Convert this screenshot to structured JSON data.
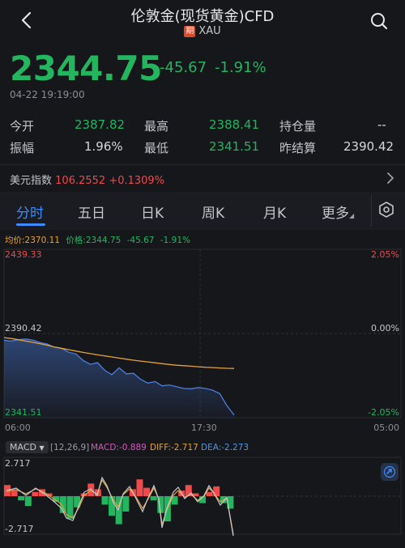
{
  "header": {
    "title": "伦敦金(现货黄金)CFD",
    "tag": "期",
    "code": "XAU"
  },
  "quote": {
    "price": "2344.75",
    "change": "-45.67",
    "change_pct": "-1.91%",
    "time": "04-22 19:19:00"
  },
  "stats": {
    "open_label": "今开",
    "open": "2387.82",
    "high_label": "最高",
    "high": "2388.41",
    "oi_label": "持仓量",
    "oi": "--",
    "amp_label": "振幅",
    "amp": "1.96%",
    "low_label": "最低",
    "low": "2341.51",
    "prev_label": "昨结算",
    "prev": "2390.42"
  },
  "usd_index": {
    "label": "美元指数",
    "value": "106.2552",
    "change": "+0.1309%"
  },
  "tabs": [
    "分时",
    "五日",
    "日K",
    "周K",
    "月K",
    "更多"
  ],
  "info_bar": {
    "avg": "均价:2370.11",
    "price": "价格:2344.75",
    "chg": "-45.67",
    "pct": "-1.91%"
  },
  "axis": {
    "y_top": "2439.33",
    "y_mid": "2390.42",
    "y_bot": "2341.51",
    "pct_top": "2.05%",
    "pct_mid": "0.00%",
    "pct_bot": "-2.05%",
    "x_start": "06:00",
    "x_mid": "17:30",
    "x_end": "05:00"
  },
  "macd": {
    "tag": "MACD",
    "params": "[12,26,9]",
    "macd": "MACD:-0.889",
    "diff": "DIFF:-2.717",
    "dea": "DEA:-2.273",
    "y_top": "2.717",
    "y_bot": "-2.717"
  },
  "colors": {
    "up": "#f04a4a",
    "down": "#23b65f",
    "price_line": "#4a7ee0",
    "avg_line": "#e3a33a",
    "accent": "#3d8cff"
  },
  "chart_data": [
    {
      "type": "line",
      "ylim": [
        2341.51,
        2439.33
      ],
      "series": [
        {
          "values": [
            2386.5,
            2386.0,
            2386.8,
            2387.2,
            2386.6,
            2385.2,
            2384.3,
            2382.5,
            2381.8,
            2379.5,
            2378.5,
            2374.8,
            2372.5,
            2373.5,
            2369.0,
            2366.5,
            2370.5,
            2367.0,
            2367.3,
            2363.8,
            2361.6,
            2362.5,
            2360.0,
            2360.5,
            2359.5,
            2358.5,
            2358.3,
            2359.0,
            2358.5,
            2357.5,
            2355.5,
            2348.5,
            2343.0
          ]
        },
        {
          "values": [
            2388.0,
            2387.5,
            2386.8,
            2386.0,
            2385.3,
            2384.5,
            2383.6,
            2382.6,
            2381.8,
            2381.0,
            2380.2,
            2379.4,
            2378.7,
            2378.0,
            2377.4,
            2376.8,
            2376.1,
            2375.5,
            2374.9,
            2374.4,
            2373.9,
            2373.4,
            2372.9,
            2372.4,
            2372.0,
            2371.7,
            2371.4,
            2371.1,
            2370.8,
            2370.6,
            2370.4,
            2370.2,
            2370.11
          ]
        }
      ]
    },
    {
      "type": "bar",
      "ylim": [
        -2.717,
        2.717
      ],
      "values": [
        0.8,
        0.4,
        -0.3,
        -0.7,
        0.3,
        0.5,
        0.2,
        -0.4,
        -1.2,
        -1.6,
        -0.8,
        0.2,
        0.9,
        0.5,
        -0.6,
        -1.4,
        -2.0,
        -1.1,
        0.5,
        1.2,
        0.6,
        -0.3,
        -1.2,
        -1.8,
        -0.6,
        0.4,
        0.8,
        0.2,
        -0.5,
        0.3,
        0.7,
        -0.5,
        -0.889
      ]
    }
  ]
}
